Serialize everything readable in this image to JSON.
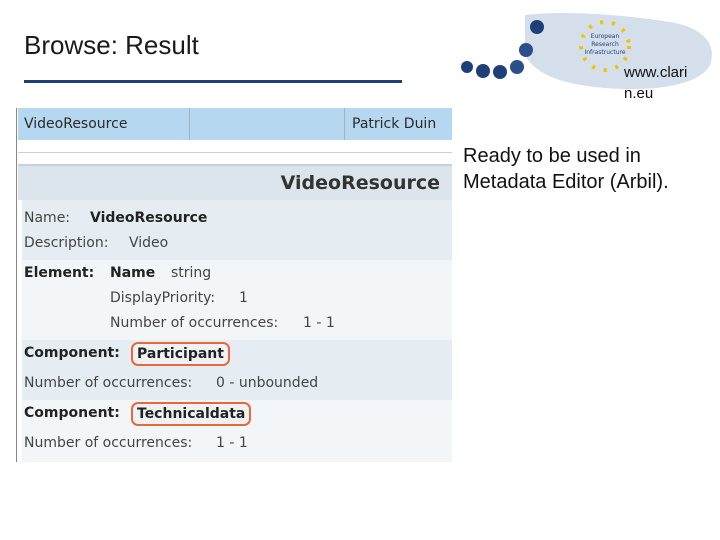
{
  "slide": {
    "title": "Browse: Result",
    "url": "www.clari n.eu",
    "note": "Ready to be used in Metadata Editor (Arbil)."
  },
  "logo": {
    "text_lines": [
      "European",
      "Research",
      "Infrastructure"
    ],
    "colors": {
      "dots": "#1f3f7a",
      "stars": "#f2c200",
      "map": "#c9d7e6"
    }
  },
  "list": {
    "name": "VideoResource",
    "owner": "Patrick Duin"
  },
  "detail": {
    "title": "VideoResource",
    "name_label": "Name:",
    "name_value": "VideoResource",
    "description_label": "Description:",
    "description_value": "Video",
    "element_label": "Element:",
    "element_name_label": "Name",
    "element_name_type": "string",
    "display_priority_label": "DisplayPriority:",
    "display_priority_value": "1",
    "element_occurrences_label": "Number of occurrences:",
    "element_occurrences_value": "1 - 1",
    "components": [
      {
        "label": "Component:",
        "name": "Participant",
        "occurrences_label": "Number of occurrences:",
        "occurrences_value": "0 - unbounded"
      },
      {
        "label": "Component:",
        "name": "Technicaldata",
        "occurrences_label": "Number of occurrences:",
        "occurrences_value": "1 - 1"
      }
    ],
    "highlight_color": "#e8683a"
  }
}
